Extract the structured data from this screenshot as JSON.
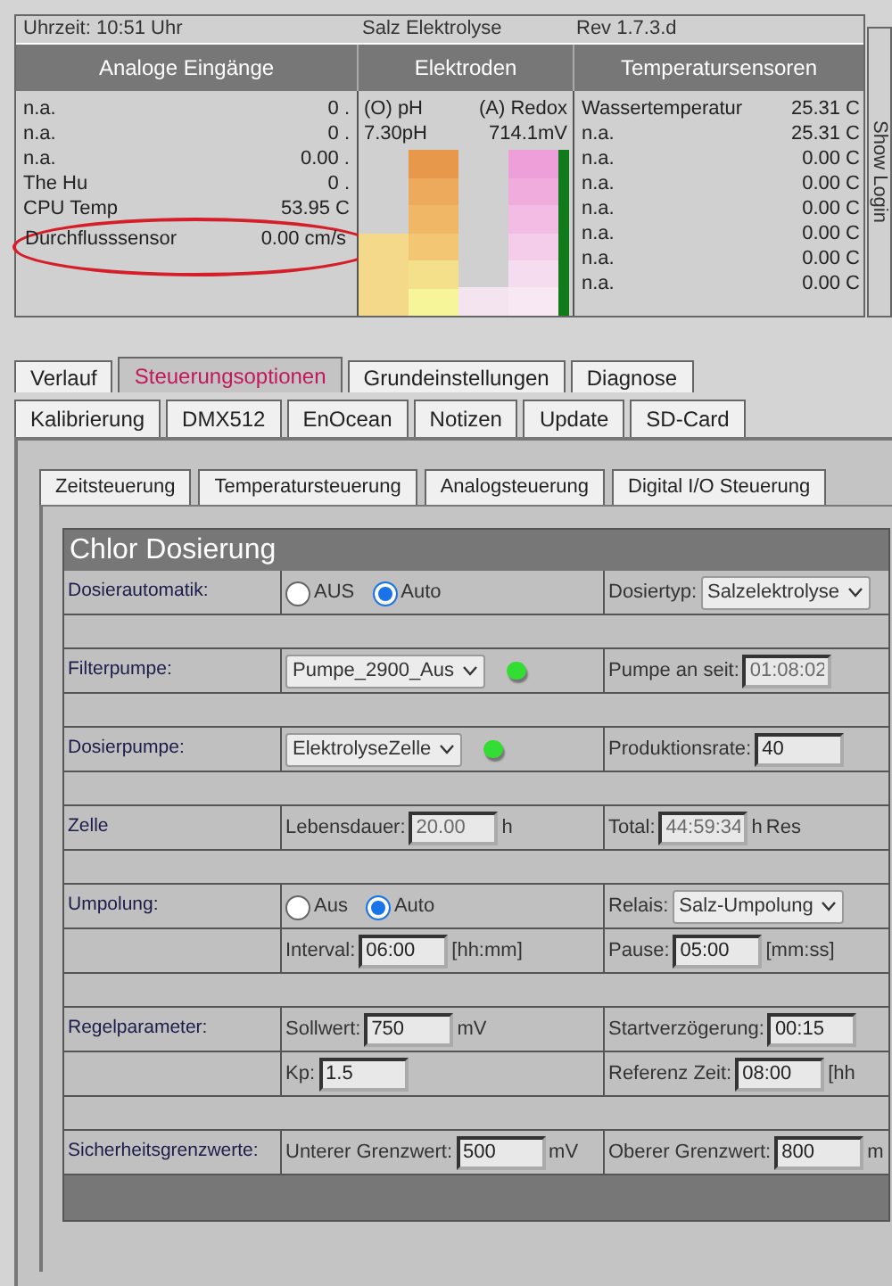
{
  "header": {
    "time": "Uhrzeit: 10:51 Uhr",
    "title": "Salz Elektrolyse",
    "revision": "Rev 1.7.3.d"
  },
  "column_headings": [
    "Analoge Eingänge",
    "Elektroden",
    "Temperatursensoren"
  ],
  "analog_inputs": [
    {
      "name": "n.a.",
      "value": "0 ."
    },
    {
      "name": "n.a.",
      "value": "0 ."
    },
    {
      "name": "n.a.",
      "value": "0.00 ."
    },
    {
      "name": "The Hu",
      "value": "0 ."
    },
    {
      "name": "CPU Temp",
      "value": "53.95 C"
    },
    {
      "name": "Durchflusssensor",
      "value": "0.00 cm/s",
      "circled": true
    }
  ],
  "electrodes": {
    "ph_label": "(O) pH",
    "redox_label": "(A) Redox",
    "ph_value": "7.30pH",
    "redox_value": "714.1mV"
  },
  "temperature_sensors": [
    {
      "name": "Wassertemperatur",
      "value": "25.31 C"
    },
    {
      "name": "n.a.",
      "value": "25.31 C"
    },
    {
      "name": "n.a.",
      "value": "0.00 C"
    },
    {
      "name": "n.a.",
      "value": "0.00 C"
    },
    {
      "name": "n.a.",
      "value": "0.00 C"
    },
    {
      "name": "n.a.",
      "value": "0.00 C"
    },
    {
      "name": "n.a.",
      "value": "0.00 C"
    },
    {
      "name": "n.a.",
      "value": "0.00 C"
    }
  ],
  "show_login": "Show Login",
  "main_tabs": [
    {
      "label": "Verlauf",
      "selected": false
    },
    {
      "label": "Steuerungsoptionen",
      "selected": true
    },
    {
      "label": "Grundeinstellungen",
      "selected": false
    },
    {
      "label": "Diagnose",
      "selected": false
    }
  ],
  "sub_tabs": [
    {
      "label": "Kalibrierung",
      "selected": false
    },
    {
      "label": "DMX512",
      "selected": false
    },
    {
      "label": "EnOcean",
      "selected": false
    },
    {
      "label": "Notizen",
      "selected": false
    },
    {
      "label": "Update",
      "selected": false
    },
    {
      "label": "SD-Card",
      "selected": false
    }
  ],
  "control_tabs": [
    {
      "label": "Zeitsteuerung",
      "selected": false
    },
    {
      "label": "Temperatursteuerung",
      "selected": false
    },
    {
      "label": "Analogsteuerung",
      "selected": false
    },
    {
      "label": "Digital I/O Steuerung",
      "selected": false
    }
  ],
  "panel_title": "Chlor Dosierung",
  "form_rows": [
    {
      "kind": "row",
      "label": "Dosierautomatik:",
      "cells": [
        [
          {
            "kind": "radio",
            "label": "AUS",
            "selected": false
          },
          {
            "kind": "radio",
            "label": "Auto",
            "selected": true
          }
        ],
        [
          {
            "kind": "text",
            "text": "Dosiertyp:"
          },
          {
            "kind": "select",
            "value": "Salzelektrolyse"
          }
        ]
      ]
    },
    {
      "kind": "spacer"
    },
    {
      "kind": "row",
      "label": "Filterpumpe:",
      "cells": [
        [
          {
            "kind": "select",
            "value": "Pumpe_2900_Aus"
          },
          {
            "kind": "led",
            "on": true
          }
        ],
        [
          {
            "kind": "text",
            "text": "Pumpe an seit:"
          },
          {
            "kind": "input",
            "value": "01:08:02",
            "disabled": true
          }
        ]
      ]
    },
    {
      "kind": "spacer"
    },
    {
      "kind": "row",
      "label": "Dosierpumpe:",
      "cells": [
        [
          {
            "kind": "select",
            "value": "ElektrolyseZelle"
          },
          {
            "kind": "led",
            "on": true
          }
        ],
        [
          {
            "kind": "text",
            "text": "Produktionsrate:"
          },
          {
            "kind": "input",
            "value": "40",
            "disabled": false
          }
        ]
      ]
    },
    {
      "kind": "spacer"
    },
    {
      "kind": "row",
      "label": "Zelle",
      "cells": [
        [
          {
            "kind": "text",
            "text": "Lebensdauer:"
          },
          {
            "kind": "input",
            "value": "20.00",
            "disabled": true
          },
          {
            "kind": "text",
            "text": "h"
          }
        ],
        [
          {
            "kind": "text",
            "text": "Total:"
          },
          {
            "kind": "input",
            "value": "44:59:34",
            "disabled": true
          },
          {
            "kind": "text",
            "text": "h"
          },
          {
            "kind": "text",
            "text": "Res"
          }
        ]
      ]
    },
    {
      "kind": "spacer"
    },
    {
      "kind": "row",
      "label": "Umpolung:",
      "cells": [
        [
          {
            "kind": "radio",
            "label": "Aus",
            "selected": false
          },
          {
            "kind": "radio",
            "label": "Auto",
            "selected": true
          }
        ],
        [
          {
            "kind": "text",
            "text": "Relais:"
          },
          {
            "kind": "select",
            "value": "Salz-Umpolung"
          }
        ]
      ]
    },
    {
      "kind": "row",
      "cells": [
        [
          {
            "kind": "text",
            "text": "Interval:"
          },
          {
            "kind": "input",
            "value": "06:00",
            "disabled": false
          },
          {
            "kind": "text",
            "text": "[hh:mm]"
          }
        ],
        [
          {
            "kind": "text",
            "text": "Pause:"
          },
          {
            "kind": "input",
            "value": "05:00",
            "disabled": false
          },
          {
            "kind": "text",
            "text": "[mm:ss]"
          }
        ]
      ]
    },
    {
      "kind": "spacer"
    },
    {
      "kind": "row",
      "label": "Regelparameter:",
      "cells": [
        [
          {
            "kind": "text",
            "text": "Sollwert:"
          },
          {
            "kind": "input",
            "value": "750",
            "disabled": false
          },
          {
            "kind": "text",
            "text": "mV"
          }
        ],
        [
          {
            "kind": "text",
            "text": "Startverzögerung:"
          },
          {
            "kind": "input",
            "value": "00:15",
            "disabled": false
          }
        ]
      ]
    },
    {
      "kind": "row",
      "cells": [
        [
          {
            "kind": "text",
            "text": "Kp:"
          },
          {
            "kind": "input",
            "value": "1.5",
            "disabled": false
          }
        ],
        [
          {
            "kind": "text",
            "text": "Referenz Zeit:"
          },
          {
            "kind": "input",
            "value": "08:00",
            "disabled": false
          },
          {
            "kind": "text",
            "text": "[hh"
          }
        ]
      ]
    },
    {
      "kind": "spacer"
    },
    {
      "kind": "row",
      "label": "Sicherheitsgrenzwerte:",
      "cells": [
        [
          {
            "kind": "text",
            "text": "Unterer Grenzwert:"
          },
          {
            "kind": "input",
            "value": "500",
            "disabled": false
          },
          {
            "kind": "text",
            "text": "mV"
          }
        ],
        [
          {
            "kind": "text",
            "text": "Oberer Grenzwert:"
          },
          {
            "kind": "input",
            "value": "800",
            "disabled": false
          },
          {
            "kind": "text",
            "text": "m"
          }
        ]
      ]
    }
  ]
}
